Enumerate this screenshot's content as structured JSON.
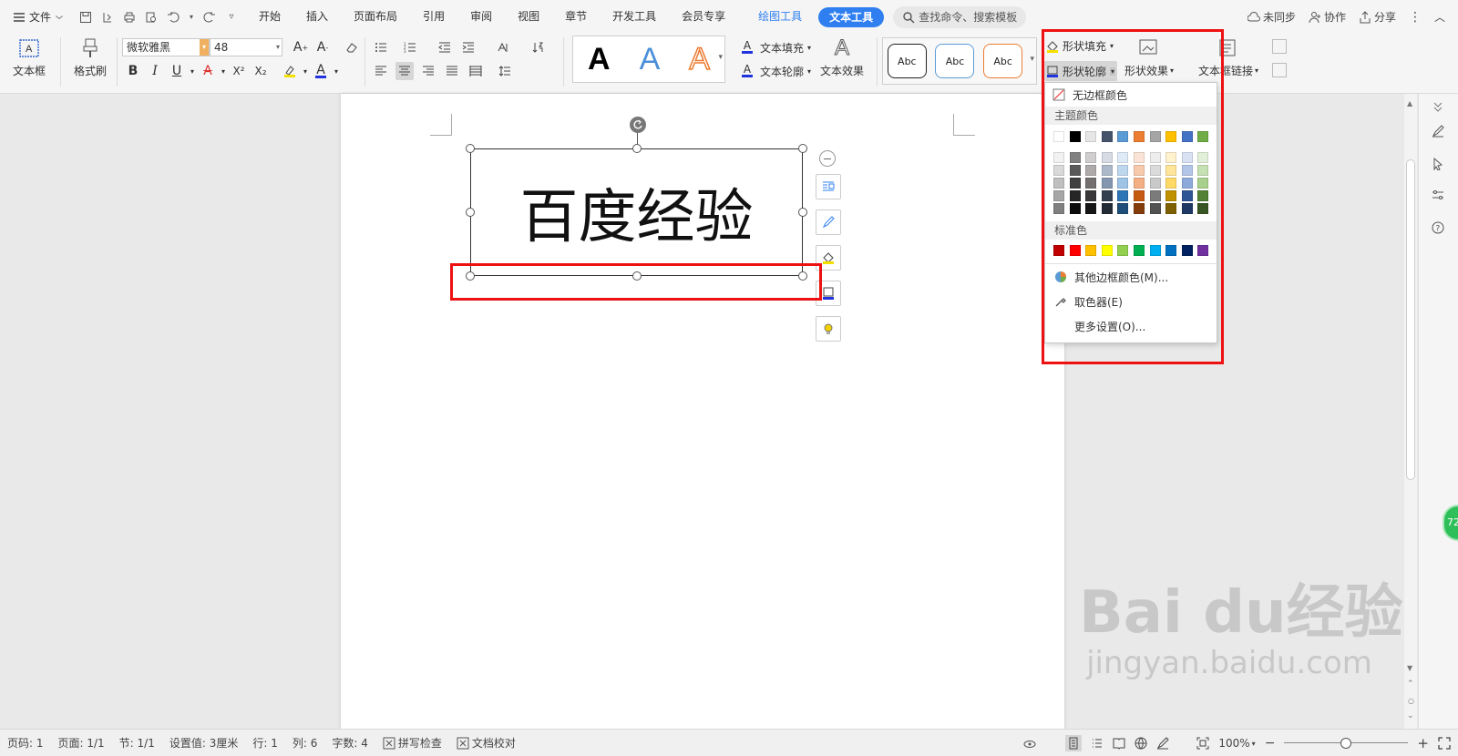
{
  "tabbar": {
    "file_label": "文件",
    "tabs": [
      "开始",
      "插入",
      "页面布局",
      "引用",
      "审阅",
      "视图",
      "章节",
      "开发工具",
      "会员专享"
    ],
    "context_tabs": {
      "draw": "绘图工具",
      "text": "文本工具"
    },
    "search_placeholder": "查找命令、搜索模板",
    "right": {
      "sync": "未同步",
      "collab": "协作",
      "share": "分享"
    }
  },
  "ribbon": {
    "textbox_label": "文本框",
    "format_painter": "格式刷",
    "font_name": "微软雅黑",
    "font_size": "48",
    "text_fill": "文本填充",
    "text_outline": "文本轮廓",
    "text_effect": "文本效果",
    "style_sample": "Abc",
    "shape_fill": "形状填充",
    "shape_outline": "形状轮廓",
    "shape_effect": "形状效果",
    "textbox_link": "文本框链接",
    "bold": "B",
    "italic": "I",
    "underline": "U",
    "letter_a": "A",
    "superscript": "X²",
    "subscript": "X₂"
  },
  "document": {
    "textbox_text": "百度经验"
  },
  "dropdown": {
    "no_border": "无边框颜色",
    "theme_colors_label": "主题颜色",
    "standard_colors_label": "标准色",
    "more_colors": "其他边框颜色(M)...",
    "eyedropper": "取色器(E)",
    "more_settings": "更多设置(O)...",
    "theme_top": [
      "#ffffff",
      "#000000",
      "#e7e6e6",
      "#44546a",
      "#5b9bd5",
      "#ed7d31",
      "#a5a5a5",
      "#ffc000",
      "#4472c4",
      "#70ad47"
    ],
    "theme_shades": [
      [
        "#f2f2f2",
        "#808080",
        "#d0cece",
        "#d6dce4",
        "#deebf6",
        "#fbe4d5",
        "#ededed",
        "#fff2cc",
        "#d9e2f3",
        "#e2efd9"
      ],
      [
        "#d9d9d9",
        "#595959",
        "#aeaaaa",
        "#acb9ca",
        "#bdd7ee",
        "#f7caac",
        "#dbdbdb",
        "#fee599",
        "#b4c6e7",
        "#c5e0b3"
      ],
      [
        "#bfbfbf",
        "#404040",
        "#757070",
        "#8497b0",
        "#9dc3e6",
        "#f4b083",
        "#c9c9c9",
        "#ffd966",
        "#8eaadb",
        "#a8d08d"
      ],
      [
        "#a6a6a6",
        "#262626",
        "#3a3838",
        "#333f4f",
        "#2e75b5",
        "#c55a11",
        "#7b7b7b",
        "#bf9000",
        "#2f5496",
        "#538135"
      ],
      [
        "#808080",
        "#0d0d0d",
        "#171616",
        "#222a35",
        "#1e4e79",
        "#833c0b",
        "#525252",
        "#7f6000",
        "#1f3864",
        "#375623"
      ]
    ],
    "standard": [
      "#c00000",
      "#ff0000",
      "#ffc000",
      "#ffff00",
      "#92d050",
      "#00b050",
      "#00b0f0",
      "#0070c0",
      "#002060",
      "#7030a0"
    ]
  },
  "status": {
    "page_num": "页码: 1",
    "pages": "页面: 1/1",
    "section": "节: 1/1",
    "setting": "设置值: 3厘米",
    "row": "行: 1",
    "col": "列: 6",
    "word_count": "字数: 4",
    "spell_check": "拼写检查",
    "doc_proof": "文档校对",
    "zoom": "100%"
  },
  "watermark": {
    "big": "Bai du经验",
    "small": "jingyan.baidu.com"
  },
  "sidebar": {
    "badge": "72"
  },
  "colors": {
    "accent": "#2f7ff0",
    "highlight_red": "#ee1111"
  }
}
